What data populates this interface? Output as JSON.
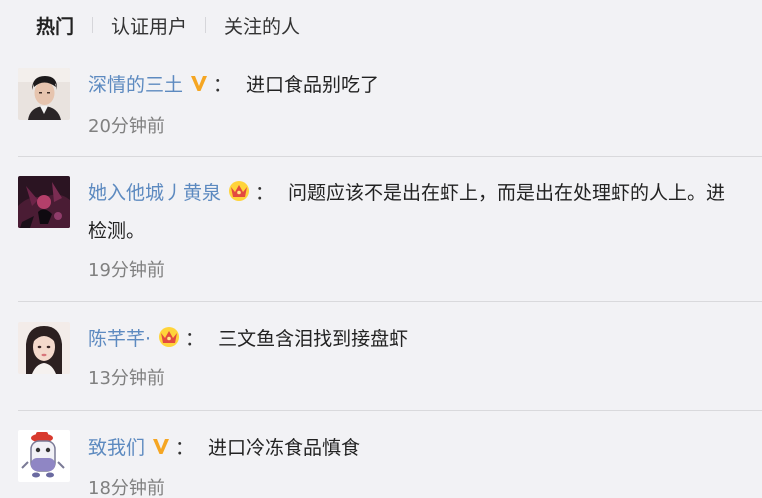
{
  "tabs": [
    {
      "label": "热门",
      "active": true
    },
    {
      "label": "认证用户",
      "active": false
    },
    {
      "label": "关注的人",
      "active": false
    }
  ],
  "colon": "：",
  "badge_icons": {
    "v": "verified-v-icon",
    "crown": "crown-icon"
  },
  "colors": {
    "username": "#5d8ac0",
    "time": "#808080",
    "v_badge": "#f5a623",
    "crown": "#f5b400"
  },
  "comments": [
    {
      "user": "深情的三土",
      "badge": "v",
      "text": "进口食品别吃了",
      "text_cont": "",
      "time": "20分钟前",
      "avatar": "man-portrait"
    },
    {
      "user": "她入他城丿黄泉",
      "badge": "crown",
      "text": "问题应该不是出在虾上，而是出在处理虾的人上。进",
      "text_cont": "检测。",
      "time": "19分钟前",
      "avatar": "dark-character"
    },
    {
      "user": "陈芊芊·",
      "badge": "crown",
      "text": "三文鱼含泪找到接盘虾",
      "text_cont": "",
      "time": "13分钟前",
      "avatar": "woman-portrait"
    },
    {
      "user": "致我们",
      "badge": "v",
      "text": "进口冷冻食品慎食",
      "text_cont": "",
      "time": "18分钟前",
      "avatar": "cartoon-character"
    }
  ]
}
